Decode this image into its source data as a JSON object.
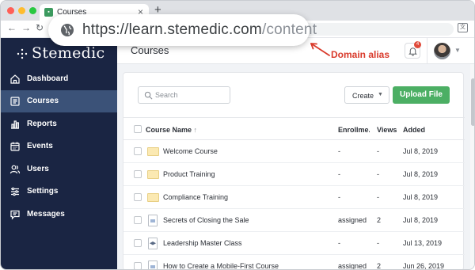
{
  "browser": {
    "tab_title": "Courses",
    "tab_close": "×",
    "new_tab": "+",
    "url_host": "https://learn.stemedic.com",
    "url_path": "/content",
    "translate_icon": "文"
  },
  "annotation": {
    "label": "Domain alias",
    "color": "#d93a2b"
  },
  "app": {
    "logo": "Stemedic"
  },
  "sidebar": {
    "items": [
      {
        "label": "Dashboard",
        "icon": "home-icon",
        "active": false
      },
      {
        "label": "Courses",
        "icon": "courses-icon",
        "active": true
      },
      {
        "label": "Reports",
        "icon": "bar-chart-icon",
        "active": false
      },
      {
        "label": "Events",
        "icon": "calendar-icon",
        "active": false
      },
      {
        "label": "Users",
        "icon": "users-icon",
        "active": false
      },
      {
        "label": "Settings",
        "icon": "sliders-icon",
        "active": false
      },
      {
        "label": "Messages",
        "icon": "message-icon",
        "active": false
      }
    ]
  },
  "header": {
    "title": "Courses",
    "notification_count": "4"
  },
  "toolbar": {
    "search_placeholder": "Search",
    "create_label": "Create",
    "upload_label": "Upload File"
  },
  "table": {
    "columns": {
      "name": "Course Name",
      "sort_indicator": "↑",
      "enrollment": "Enrollme...",
      "views": "Views",
      "added": "Added"
    },
    "rows": [
      {
        "name": "Welcome Course",
        "type": "folder",
        "enrollment": "-",
        "views": "-",
        "added": "Jul 8, 2019"
      },
      {
        "name": "Product Training",
        "type": "folder",
        "enrollment": "-",
        "views": "-",
        "added": "Jul 8, 2019"
      },
      {
        "name": "Compliance Training",
        "type": "folder",
        "enrollment": "-",
        "views": "-",
        "added": "Jul 8, 2019"
      },
      {
        "name": "Secrets of Closing the Sale",
        "type": "document",
        "enrollment": "assigned",
        "views": "2",
        "added": "Jul 8, 2019"
      },
      {
        "name": "Leadership Master Class",
        "type": "course",
        "enrollment": "-",
        "views": "-",
        "added": "Jul 13, 2019"
      },
      {
        "name": "How to Create a Mobile-First Course",
        "type": "document",
        "enrollment": "assigned",
        "views": "2",
        "added": "Jun 26, 2019"
      }
    ]
  },
  "colors": {
    "sidebar_bg": "#1a2543",
    "sidebar_active": "#3b5278",
    "accent_green": "#4caf64",
    "badge_red": "#e04a3a"
  }
}
